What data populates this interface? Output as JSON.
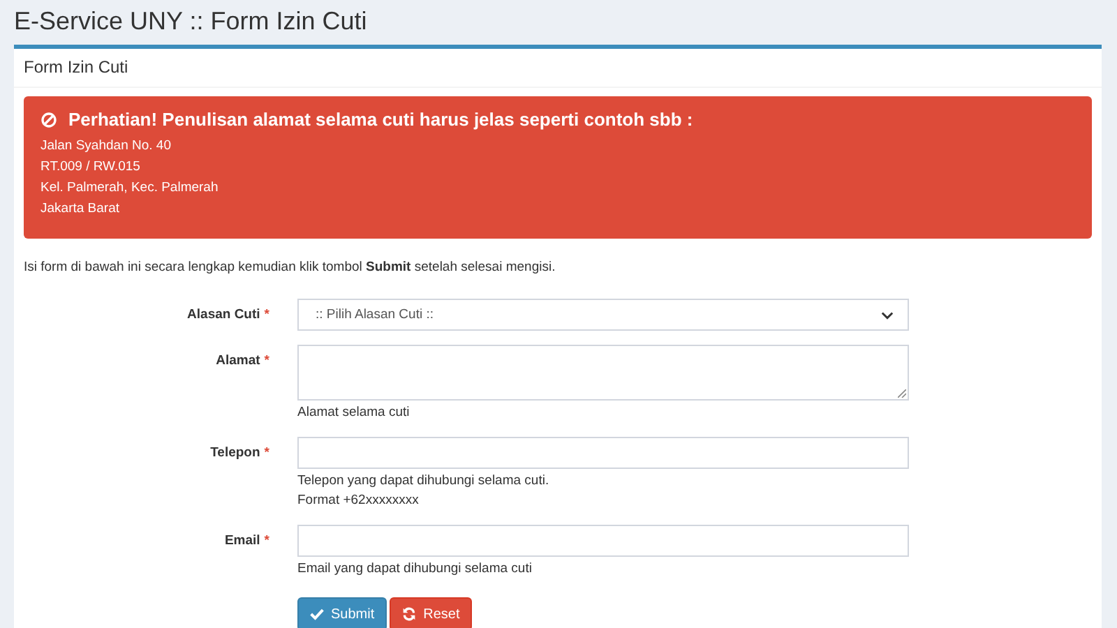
{
  "page_title": "E-Service UNY :: Form Izin Cuti",
  "box": {
    "title": "Form Izin Cuti"
  },
  "alert": {
    "title": "Perhatian! Penulisan alamat selama cuti harus jelas seperti contoh sbb :",
    "lines": [
      "Jalan Syahdan No. 40",
      "RT.009 / RW.015",
      "Kel. Palmerah, Kec. Palmerah",
      "Jakarta Barat"
    ]
  },
  "intro": "Isi form di bawah ini secara lengkap kemudian klik tombol **Submit** setelah selesai mengisi.",
  "fields": [
    {
      "label": "Alasan Cuti",
      "required_mark": "*",
      "kind": "select",
      "value": ":: Pilih Alasan Cuti ::"
    },
    {
      "label": "Alamat",
      "required_mark": "*",
      "kind": "textarea",
      "help": [
        "Alamat selama cuti"
      ]
    },
    {
      "label": "Telepon",
      "required_mark": "*",
      "kind": "text",
      "help": [
        "Telepon yang dapat dihubungi selama cuti.",
        "Format +62xxxxxxxx"
      ]
    },
    {
      "label": "Email",
      "required_mark": "*",
      "kind": "text",
      "help": [
        "Email yang dapat dihubungi selama cuti"
      ]
    }
  ],
  "buttons": [
    {
      "label": "Submit",
      "kind": "submit"
    },
    {
      "label": "Reset",
      "kind": "reset"
    }
  ]
}
